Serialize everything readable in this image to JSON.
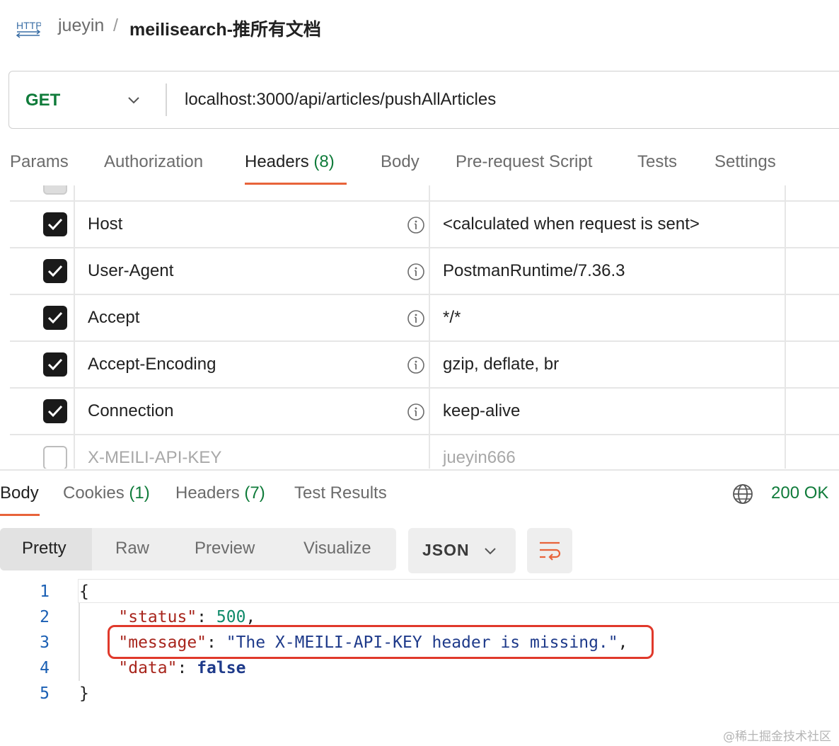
{
  "breadcrumb": {
    "icon_text": "HTTP",
    "workspace": "jueyin",
    "separator": "/",
    "request_name": "meilisearch-推所有文档"
  },
  "request": {
    "method": "GET",
    "url": "localhost:3000/api/articles/pushAllArticles"
  },
  "request_tabs": [
    {
      "label": "Params"
    },
    {
      "label": "Authorization"
    },
    {
      "label": "Headers",
      "count": "(8)",
      "active": true
    },
    {
      "label": "Body"
    },
    {
      "label": "Pre-request Script"
    },
    {
      "label": "Tests"
    },
    {
      "label": "Settings"
    }
  ],
  "headers": [
    {
      "key": "Host",
      "value": "<calculated when request is sent>",
      "enabled": true
    },
    {
      "key": "User-Agent",
      "value": "PostmanRuntime/7.36.3",
      "enabled": true
    },
    {
      "key": "Accept",
      "value": "*/*",
      "enabled": true
    },
    {
      "key": "Accept-Encoding",
      "value": "gzip, deflate, br",
      "enabled": true
    },
    {
      "key": "Connection",
      "value": "keep-alive",
      "enabled": true
    },
    {
      "key": "X-MEILI-API-KEY",
      "value": "jueyin666",
      "enabled": false
    }
  ],
  "response_tabs": [
    {
      "label": "Body",
      "active": true
    },
    {
      "label": "Cookies",
      "count": "(1)"
    },
    {
      "label": "Headers",
      "count": "(7)"
    },
    {
      "label": "Test Results"
    }
  ],
  "response_status": "200 OK",
  "view_modes": [
    "Pretty",
    "Raw",
    "Preview",
    "Visualize"
  ],
  "active_view_mode": "Pretty",
  "format": "JSON",
  "code": {
    "line_numbers": [
      "1",
      "2",
      "3",
      "4",
      "5"
    ],
    "open_brace": "{",
    "close_brace": "}",
    "status_key": "\"status\"",
    "status_value": "500",
    "message_key": "\"message\"",
    "message_value": "\"The X-MEILI-API-KEY header is missing.\"",
    "data_key": "\"data\"",
    "data_value": "false"
  },
  "watermark": "@稀土掘金技术社区",
  "colors": {
    "accent": "#e8633a",
    "method_green": "#0f7b3a",
    "highlight_box": "#e0392b"
  }
}
